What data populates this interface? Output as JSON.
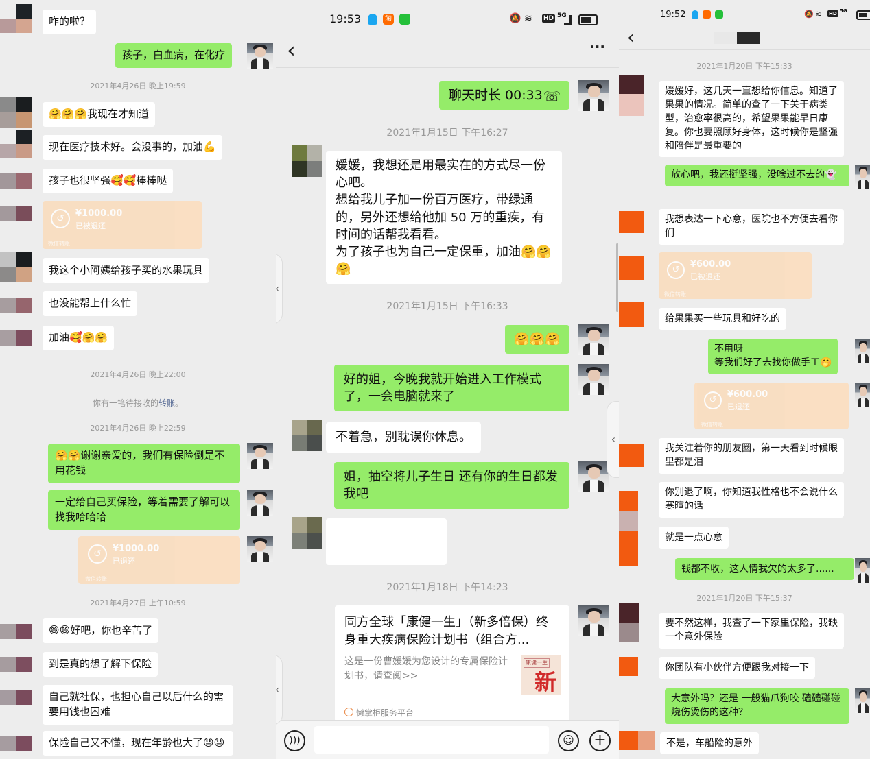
{
  "left": {
    "messages": {
      "m1": "咋的啦？",
      "m2": "孩子，白血病，在化疗",
      "m3": "🤗🤗🤗我现在才知道",
      "m4": "现在医疗技术好。会没事的，加油💪",
      "m5": "孩子也很坚强🥰🥰棒棒哒",
      "m6": "我这个小阿姨给孩子买的水果玩具",
      "m7": "也没能帮上什么忙",
      "m8": "加油🥰🤗🤗",
      "m9": "🤗🤗谢谢亲爱的，我们有保险倒是不用花钱",
      "m10": "一定给自己买保险，等着需要了解可以找我哈哈哈",
      "m11": "😄😄好吧，你也辛苦了",
      "m12": "到是真的想了解下保险",
      "m13": "自己就社保，也担心自己以后什么的需要用钱也困难",
      "m14": "保险自己又不懂，现在年龄也大了😓😓"
    },
    "timestamps": {
      "t1": "2021年4月26日 晚上19:59",
      "t2": "2021年4月26日 晚上22:00",
      "t3": "2021年4月26日 晚上22:59",
      "t4": "2021年4月27日 上午10:59"
    },
    "system_prefix": "你有一笔待接收的",
    "system_link": "转账",
    "system_suffix": "。",
    "transfers": {
      "tr1_amount": "¥1000.00",
      "tr1_status": "已被退还",
      "tr1_footer": "微信转账",
      "tr2_amount": "¥1000.00",
      "tr2_status": "已退还",
      "tr2_footer": "微信转账"
    }
  },
  "middle": {
    "status": {
      "time": "19:53",
      "app_icons": [
        "qq-icon",
        "taobao-icon",
        "wechat-icon"
      ],
      "hd": "HD",
      "net": "5G"
    },
    "nav": {
      "back": "‹",
      "more": "···"
    },
    "call_label": "聊天时长 00:33",
    "timestamps": {
      "t1": "2021年1月15日 下午16:27",
      "t2": "2021年1月15日 下午16:33",
      "t3": "2021年1月18日 下午14:23"
    },
    "messages": {
      "m1": "媛媛，我想还是用最实在的方式尽一份心吧。\n想给我儿子加一份百万医疗，带绿通的，另外还想给他加 50 万的重疾，有时间的话帮我看看。\n为了孩子也为自己一定保重，加油🤗🤗🤗",
      "m2": "🤗🤗🤗",
      "m3": "好的姐，今晚我就开始进入工作模式了，一会电脑就来了",
      "m4": "不着急，别耽误你休息。",
      "m5": "姐，抽空将儿子生日 还有你的生日都发我吧",
      "m6": ""
    },
    "card": {
      "title": "同方全球「康健一生」（新多倍保）终身重大疾病保险计划书（组合方...",
      "desc": "这是一份曹媛媛为您设计的专属保险计划书，请查阅>>",
      "thumb_text": "新",
      "thumb_small": "康健一生",
      "source": "懒掌柜服务平台"
    },
    "input": {
      "voice": "voice-icon",
      "emoji": "emoji-icon",
      "plus": "plus-icon",
      "value": ""
    }
  },
  "right": {
    "status": {
      "time": "19:52",
      "hd": "HD",
      "net": "5G"
    },
    "nav": {
      "back": "‹"
    },
    "timestamps": {
      "t1": "2021年1月20日 下午15:33",
      "t2": "2021年1月20日 下午15:37"
    },
    "messages": {
      "m1": "媛媛好，这几天一直想给你信息。知道了果果的情况。简单的查了一下关于病类型，治愈率很高的，希望果果能早日康复。你也要照顾好身体，这时候你是坚强和陪伴是最重要的",
      "m2": "放心吧，我还挺坚强，没啥过不去的👻",
      "m3": "我想表达一下心意，医院也不方便去看你们",
      "m4": "给果果买一些玩具和好吃的",
      "m5": "不用呀\n等我们好了去找你做手工🤭",
      "m6": "我关注着你的朋友圈，第一天看到时候眼里都是泪",
      "m7": "你别退了啊，你知道我性格也不会说什么寒暄的话",
      "m8": "就是一点心意",
      "m9": "钱都不收，这人情我欠的太多了......",
      "m10": "要不然这样，我查了一下家里保险，我缺一个意外保险",
      "m11": "你团队有小伙伴方便跟我对接一下",
      "m12": "大意外吗？还是 一般猫爪狗咬 磕磕碰碰 烧伤烫伤的这种？",
      "m13": "不是，车船险的意外"
    },
    "transfers": {
      "tr1_amount": "¥600.00",
      "tr1_status": "已被退还",
      "tr1_footer": "微信转账",
      "tr2_amount": "¥600.00",
      "tr2_status": "已退还",
      "tr2_footer": "微信转账"
    }
  }
}
